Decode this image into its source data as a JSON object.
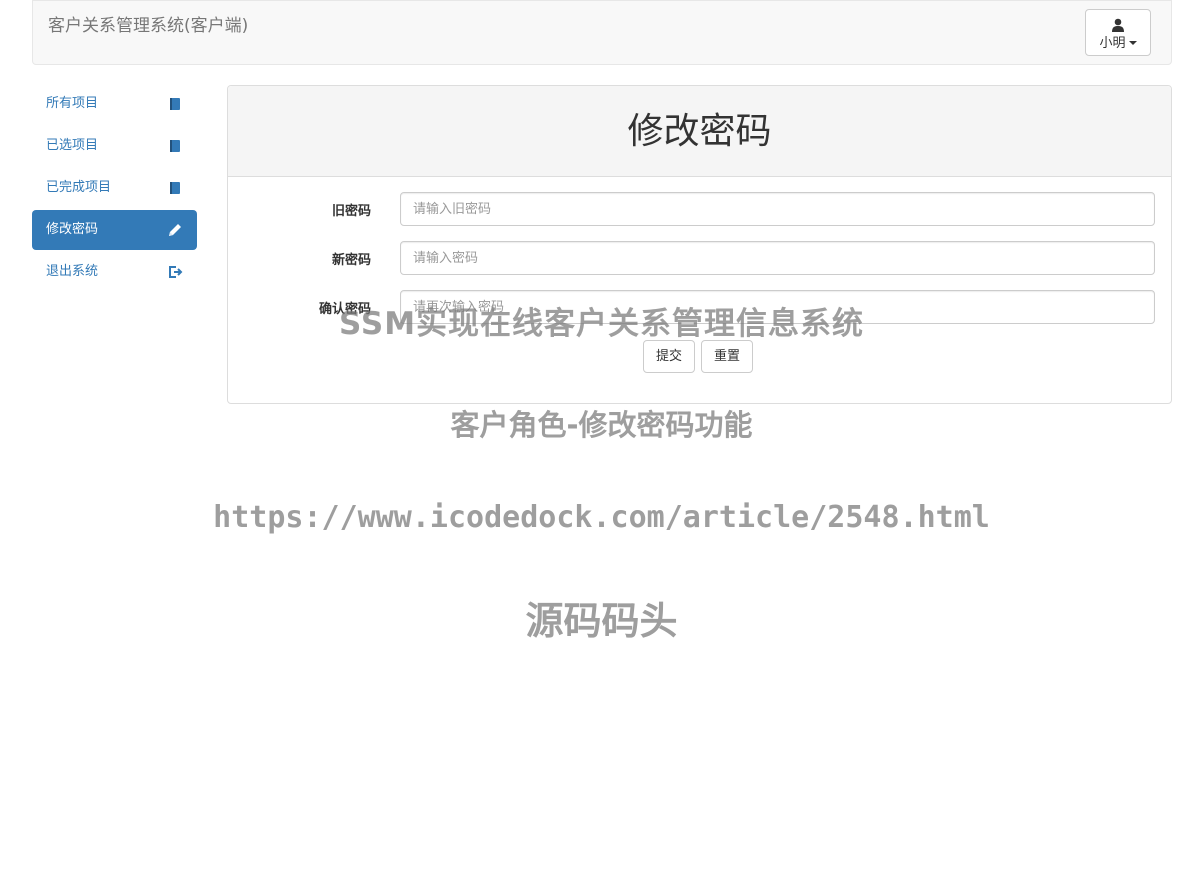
{
  "header": {
    "brand": "客户关系管理系统(客户端)",
    "user_name": "小明"
  },
  "sidebar": {
    "items": [
      {
        "label": "所有项目",
        "icon": "book-icon"
      },
      {
        "label": "已选项目",
        "icon": "book-icon"
      },
      {
        "label": "已完成项目",
        "icon": "book-icon"
      },
      {
        "label": "修改密码",
        "icon": "pencil-icon",
        "active": true
      },
      {
        "label": "退出系统",
        "icon": "logout-icon"
      }
    ]
  },
  "panel": {
    "title": "修改密码",
    "fields": [
      {
        "label": "旧密码",
        "placeholder": "请输入旧密码",
        "value": ""
      },
      {
        "label": "新密码",
        "placeholder": "请输入密码",
        "value": ""
      },
      {
        "label": "确认密码",
        "placeholder": "请再次输入密码",
        "value": ""
      }
    ],
    "submit_label": "提交",
    "reset_label": "重置"
  },
  "watermark": {
    "line1": "SSM实现在线客户关系管理信息系统",
    "line2": "客户角色-修改密码功能",
    "line3": "https://www.icodedock.com/article/2548.html",
    "line4": "源码码头"
  },
  "colors": {
    "accent": "#337ab7",
    "navbar_bg": "#f8f8f8",
    "panel_heading_bg": "#f5f5f5"
  }
}
